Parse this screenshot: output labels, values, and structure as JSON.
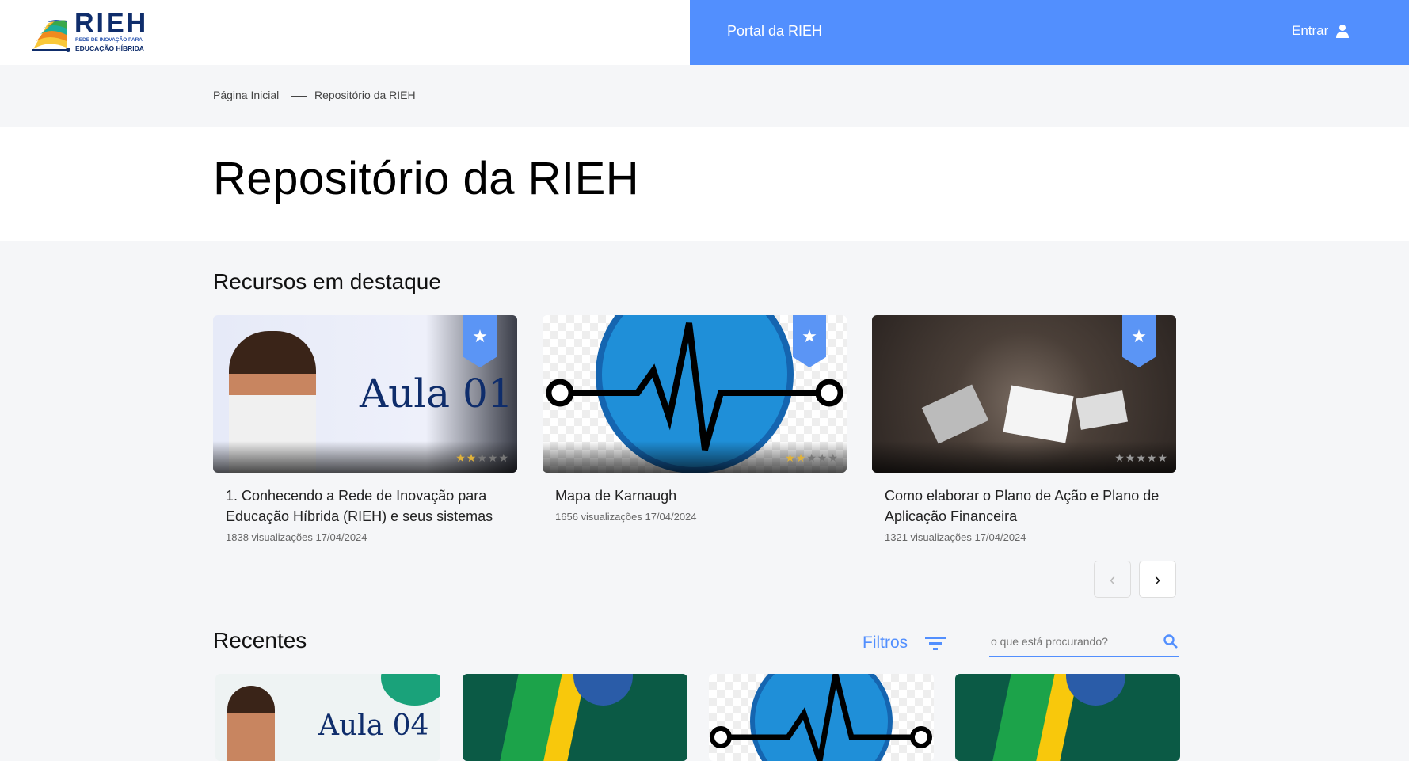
{
  "header": {
    "logo_text": "RIEH",
    "logo_sub1": "REDE DE INOVAÇÃO PARA",
    "logo_sub2": "EDUCAÇÃO HÍBRIDA",
    "portal": "Portal da RIEH",
    "login": "Entrar"
  },
  "breadcrumb": [
    "Página Inicial",
    "Repositório da RIEH"
  ],
  "page_title": "Repositório da RIEH",
  "featured": {
    "heading": "Recursos em destaque",
    "cards": [
      {
        "title": "1. Conhecendo a Rede de Inovação para Educação Híbrida (RIEH) e seus sistemas",
        "meta": "1838 visualizações 17/04/2024",
        "rating": 2,
        "image_text": "Aula 01"
      },
      {
        "title": "Mapa de Karnaugh",
        "meta": "1656 visualizações 17/04/2024",
        "rating": 2
      },
      {
        "title": "Como elaborar o Plano de Ação e Plano de Aplicação Financeira",
        "meta": "1321 visualizações 17/04/2024",
        "rating": 0
      }
    ]
  },
  "recent": {
    "heading": "Recentes",
    "filters": "Filtros",
    "search_placeholder": "o que está procurando?",
    "first_image_text": "Aula 04"
  }
}
